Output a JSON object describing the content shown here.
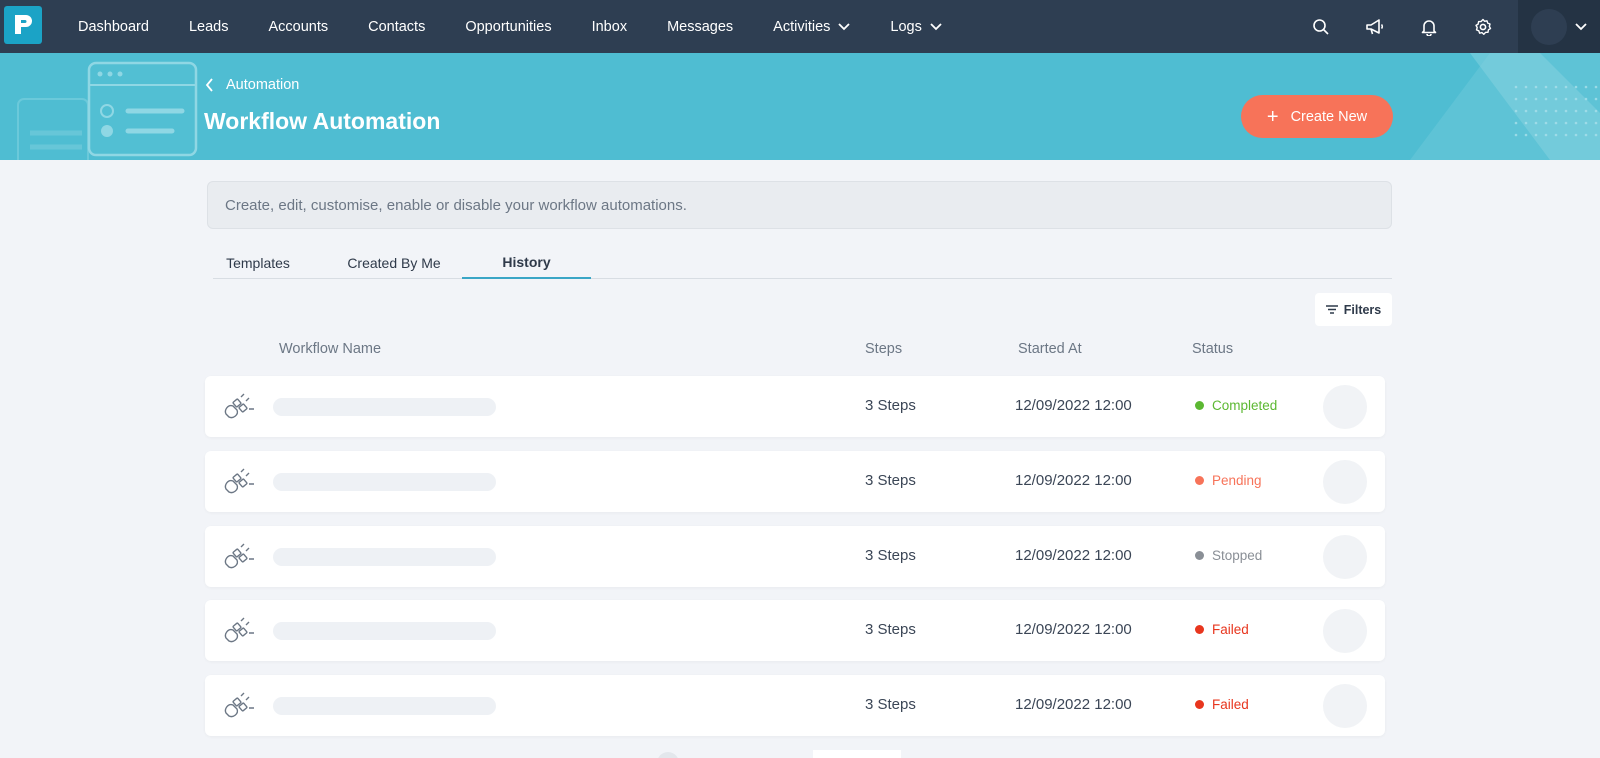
{
  "nav": {
    "items": [
      {
        "label": "Dashboard",
        "dropdown": false
      },
      {
        "label": "Leads",
        "dropdown": false
      },
      {
        "label": "Accounts",
        "dropdown": false
      },
      {
        "label": "Contacts",
        "dropdown": false
      },
      {
        "label": "Opportunities",
        "dropdown": false
      },
      {
        "label": "Inbox",
        "dropdown": false
      },
      {
        "label": "Messages",
        "dropdown": false
      },
      {
        "label": "Activities",
        "dropdown": true
      },
      {
        "label": "Logs",
        "dropdown": true
      }
    ],
    "right_icons": [
      "search-icon",
      "megaphone-icon",
      "bell-icon",
      "gear-icon"
    ]
  },
  "header": {
    "breadcrumb": "Automation",
    "title": "Workflow Automation",
    "create_label": "Create New"
  },
  "info_text": "Create, edit, customise, enable or disable your workflow automations.",
  "tabs": {
    "templates": "Templates",
    "created_by_me": "Created By Me",
    "history": "History",
    "active": "History"
  },
  "filters_label": "Filters",
  "table": {
    "headers": {
      "name": "Workflow Name",
      "steps": "Steps",
      "started": "Started At",
      "status": "Status"
    },
    "rows": [
      {
        "steps": "3 Steps",
        "started": "12/09/2022 12:00",
        "status": "Completed",
        "status_color": "#5cb832"
      },
      {
        "steps": "3 Steps",
        "started": "12/09/2022 12:00",
        "status": "Pending",
        "status_color": "#f77359"
      },
      {
        "steps": "3 Steps",
        "started": "12/09/2022 12:00",
        "status": "Stopped",
        "status_color": "#8a8f96"
      },
      {
        "steps": "3 Steps",
        "started": "12/09/2022 12:00",
        "status": "Failed",
        "status_color": "#e8361e"
      },
      {
        "steps": "3 Steps",
        "started": "12/09/2022 12:00",
        "status": "Failed",
        "status_color": "#e8361e"
      }
    ]
  },
  "colors": {
    "nav_bg": "#2e3e52",
    "hero_bg": "#4fbdd2",
    "accent": "#f77359",
    "tab_active": "#3aa6c6"
  }
}
